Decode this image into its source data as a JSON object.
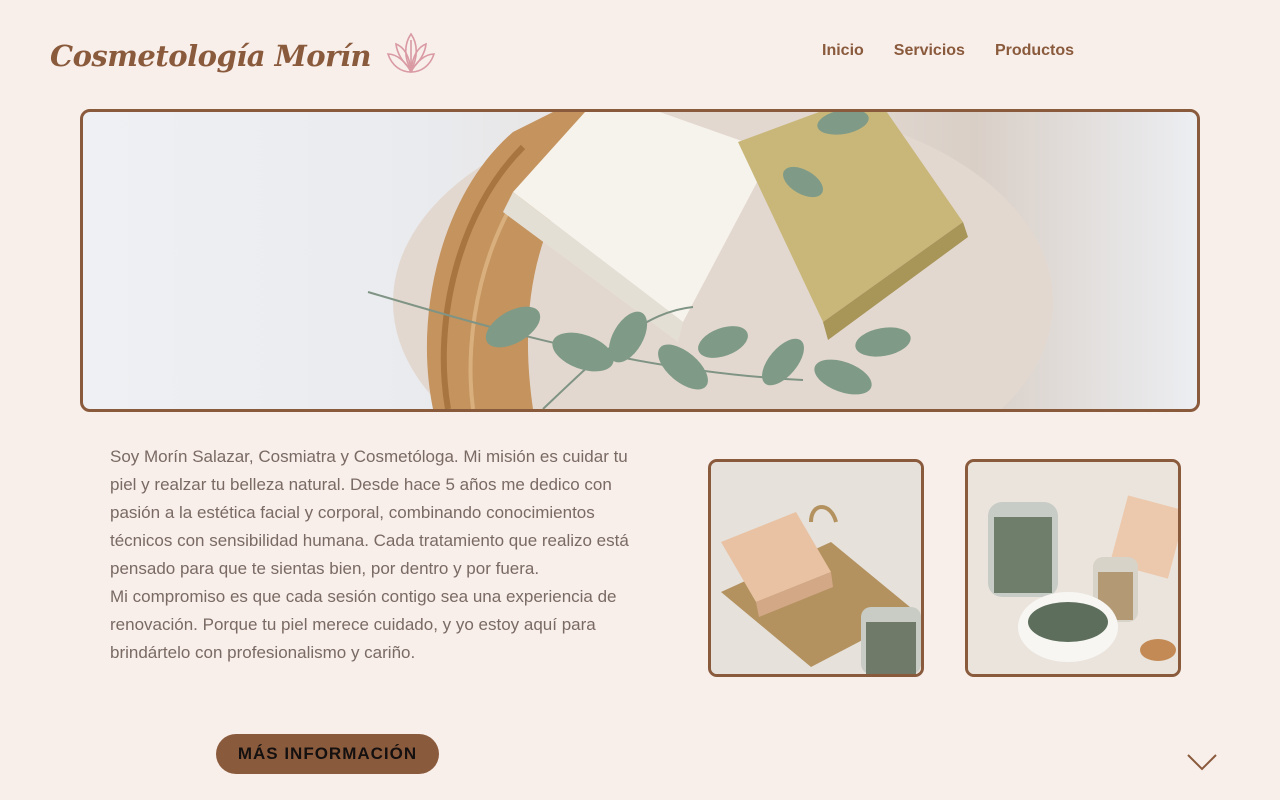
{
  "brand": {
    "name": "Cosmetología Morín",
    "logo_icon": "lotus-icon"
  },
  "nav": {
    "items": [
      "Inicio",
      "Servicios",
      "Productos"
    ]
  },
  "about": {
    "paragraph_1": "Soy Morín Salazar, Cosmiatra y Cosmetóloga. Mi misión es cuidar tu piel y realzar tu belleza natural. Desde hace  5 años me dedico con pasión a la estética facial y corporal, combinando conocimientos técnicos con sensibilidad humana. Cada tratamiento que realizo está pensado para que te sientas bien, por dentro y por fuera.",
    "paragraph_2": "Mi compromiso es que cada sesión contigo sea una experiencia de renovación. Porque tu piel merece cuidado, y yo estoy aquí para brindártelo con profesionalismo y cariño."
  },
  "cta": {
    "label": "MÁS INFORMACIÓN"
  },
  "scroll": {
    "icon": "chevron-down-icon"
  },
  "colors": {
    "background": "#f8eeea",
    "accent": "#8a5a3c",
    "text": "#7a6a64",
    "logo_pink": "#d99aa4"
  }
}
